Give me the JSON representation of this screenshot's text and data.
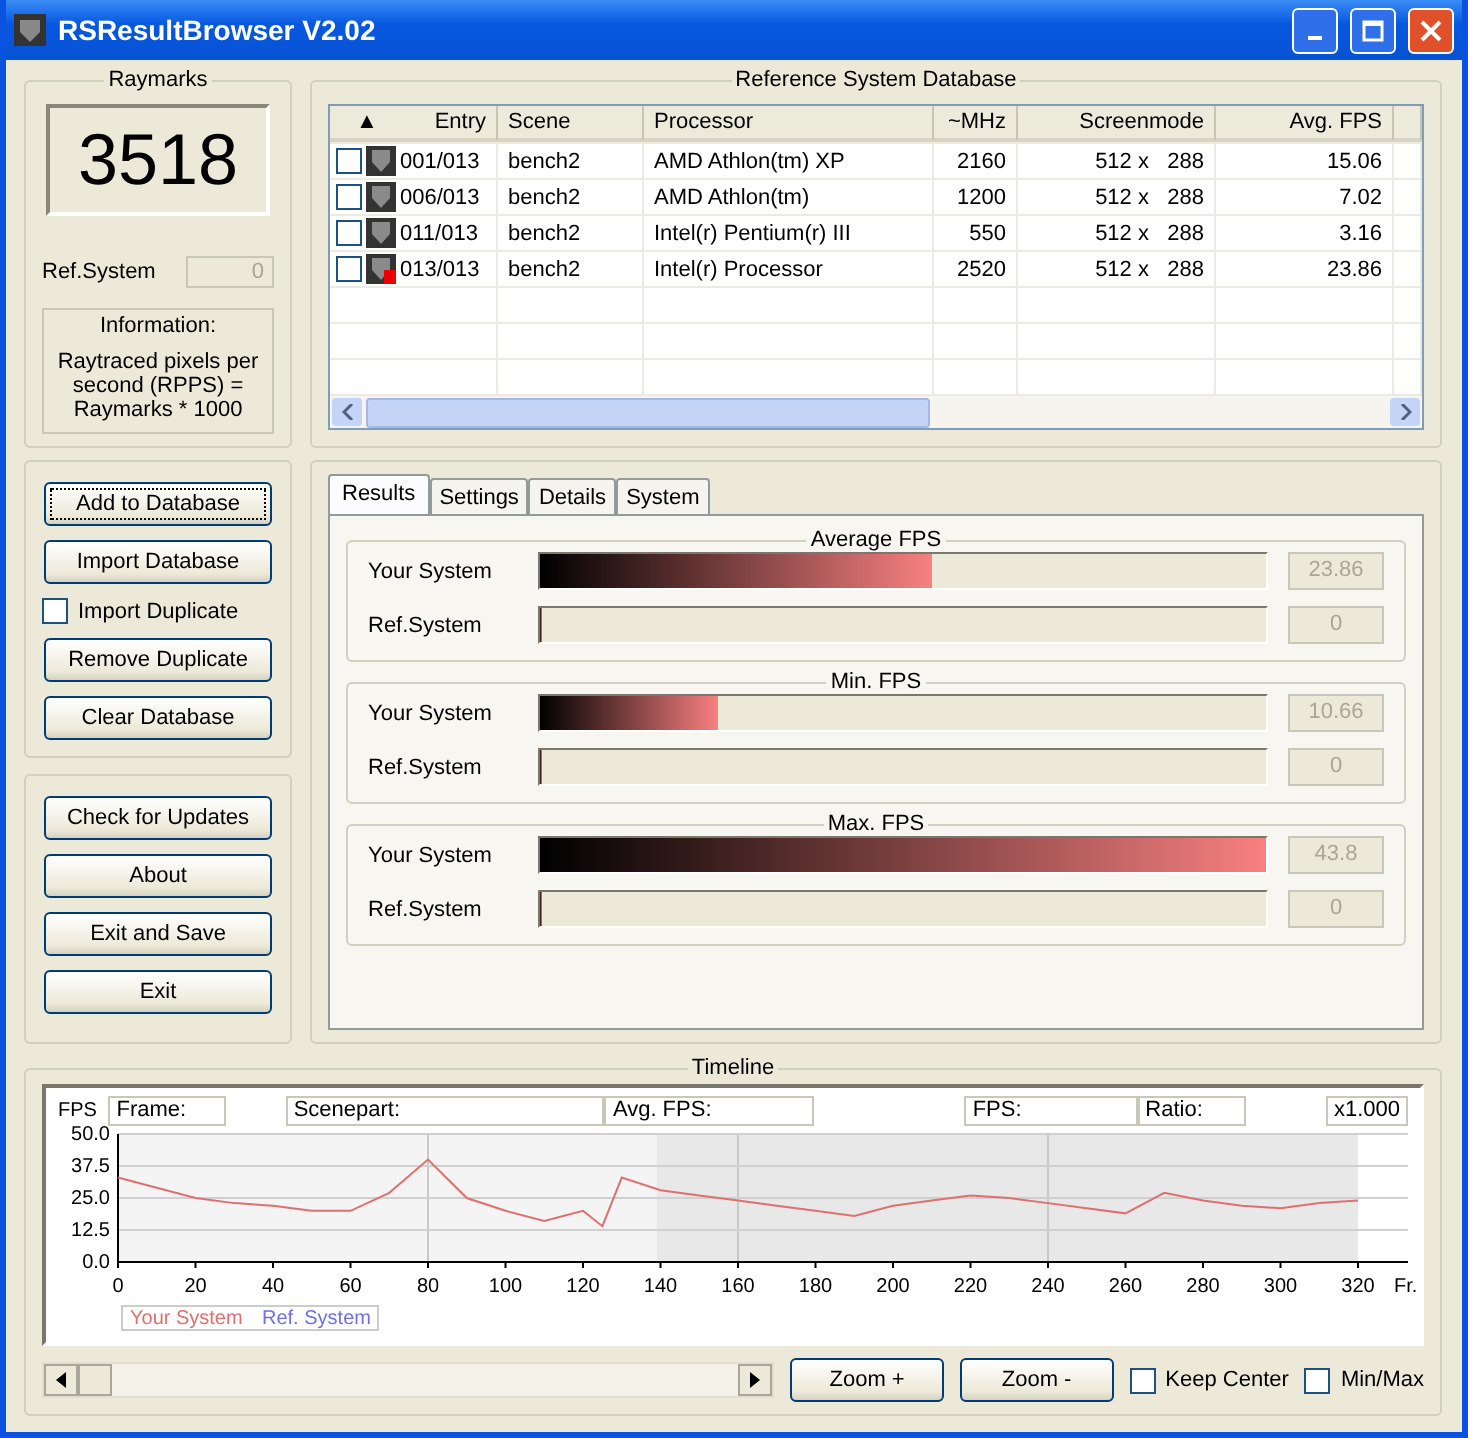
{
  "window": {
    "title": "RSResultBrowser V2.02"
  },
  "raymarks": {
    "title": "Raymarks",
    "score": "3518",
    "ref_label": "Ref.System",
    "ref_value": "0",
    "info_title": "Information:",
    "info_text": "Raytraced pixels per second (RPPS) = Raymarks * 1000"
  },
  "database_actions": {
    "buttons": [
      {
        "label": "Add to Database",
        "focused": true
      },
      {
        "label": "Import Database",
        "focused": false
      }
    ],
    "import_duplicate": {
      "label": "Import Duplicate",
      "checked": false
    },
    "buttons_2": [
      {
        "label": "Remove Duplicate",
        "focused": false
      },
      {
        "label": "Clear Database",
        "focused": false
      }
    ]
  },
  "app_actions": {
    "buttons": [
      "Check for Updates",
      "About",
      "Exit and Save",
      "Exit"
    ]
  },
  "reference_db": {
    "title": "Reference System Database",
    "sort_indicator": "▲",
    "columns": [
      "Entry",
      "Scene",
      "Processor",
      "~MHz",
      "Screenmode",
      "Avg. FPS"
    ],
    "rows": [
      {
        "checked": false,
        "flagged": false,
        "cells": [
          "001/013",
          "bench2",
          "AMD Athlon(tm) XP",
          "2160",
          "512 x   288",
          "15.06"
        ]
      },
      {
        "checked": false,
        "flagged": false,
        "cells": [
          "006/013",
          "bench2",
          "AMD Athlon(tm)",
          "1200",
          "512 x   288",
          "7.02"
        ]
      },
      {
        "checked": false,
        "flagged": false,
        "cells": [
          "011/013",
          "bench2",
          "Intel(r) Pentium(r) III",
          "550",
          "512 x   288",
          "3.16"
        ]
      },
      {
        "checked": false,
        "flagged": true,
        "cells": [
          "013/013",
          "bench2",
          "Intel(r) Processor",
          "2520",
          "512 x   288",
          "23.86"
        ]
      }
    ]
  },
  "tabs": [
    {
      "label": "Results",
      "selected": true
    },
    {
      "label": "Settings",
      "selected": false
    },
    {
      "label": "Details",
      "selected": false
    },
    {
      "label": "System",
      "selected": false
    }
  ],
  "results": [
    {
      "title": "Average FPS",
      "bars": [
        {
          "label": "Your System",
          "level": 0.54,
          "reading": "23.86"
        },
        {
          "label": "Ref.System",
          "level": 0,
          "reading": "0"
        }
      ]
    },
    {
      "title": "Min. FPS",
      "bars": [
        {
          "label": "Your System",
          "level": 0.245,
          "reading": "10.66"
        },
        {
          "label": "Ref.System",
          "level": 0,
          "reading": "0"
        }
      ]
    },
    {
      "title": "Max. FPS",
      "bars": [
        {
          "label": "Your System",
          "level": 1,
          "reading": "43.8"
        },
        {
          "label": "Ref.System",
          "level": 0,
          "reading": "0"
        }
      ]
    }
  ],
  "timeline": {
    "title": "Timeline",
    "y_unit": "FPS",
    "readouts": [
      "Frame:",
      "Scenepart:",
      "Avg. FPS:",
      "FPS:",
      "Ratio:"
    ],
    "zoom_factor": "x1.000",
    "x_unit": "Fr.",
    "chart_data": {
      "type": "line",
      "grid": true,
      "x": [
        0,
        10,
        20,
        30,
        40,
        50,
        60,
        70,
        80,
        90,
        100,
        110,
        120,
        125,
        130,
        140,
        150,
        160,
        170,
        180,
        190,
        200,
        210,
        220,
        230,
        240,
        250,
        260,
        270,
        280,
        290,
        300,
        310,
        320
      ],
      "xlim": [
        0,
        320
      ],
      "ylim": [
        0,
        50
      ],
      "xticks": [
        0,
        20,
        40,
        60,
        80,
        100,
        120,
        140,
        160,
        180,
        200,
        220,
        240,
        260,
        280,
        300,
        320
      ],
      "yticks": [
        {
          "value": 0,
          "label": "0.0"
        },
        {
          "value": 12.5,
          "label": "12.5"
        },
        {
          "value": 25,
          "label": "25.0"
        },
        {
          "value": 37.5,
          "label": "37.5"
        },
        {
          "value": 50,
          "label": "50.0"
        }
      ],
      "series": [
        {
          "name": "Your System",
          "color": "#e07070",
          "values": [
            33,
            29,
            25,
            23,
            22,
            20,
            20,
            27,
            40,
            25,
            20,
            16,
            20,
            14,
            33,
            28,
            26,
            24,
            22,
            20,
            18,
            22,
            24,
            26,
            25,
            23,
            21,
            19,
            27,
            24,
            22,
            21,
            23,
            24
          ]
        },
        {
          "name": "Ref. System",
          "color": "#7070e0",
          "values": [
            null,
            null,
            null,
            null,
            null,
            null,
            null,
            null,
            null,
            null,
            null,
            null,
            null,
            null,
            null,
            null,
            null,
            null,
            null,
            null,
            null,
            null,
            null,
            null,
            null,
            null,
            null,
            null,
            null,
            null,
            null,
            null,
            null,
            null
          ]
        }
      ]
    },
    "zoom_in": "Zoom +",
    "zoom_out": "Zoom -",
    "options": [
      {
        "label": "Keep Center",
        "checked": false
      },
      {
        "label": "Min/Max",
        "checked": false
      }
    ]
  }
}
